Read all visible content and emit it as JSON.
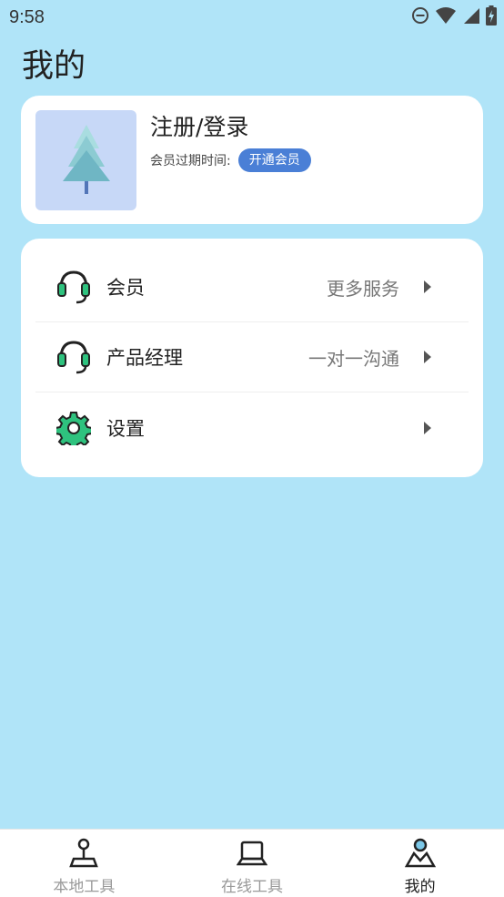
{
  "status_bar": {
    "time": "9:58"
  },
  "page": {
    "title": "我的"
  },
  "profile": {
    "login_label": "注册/登录",
    "member_expiry_label": "会员过期时间:",
    "open_member_button": "开通会员"
  },
  "menu": {
    "items": [
      {
        "label": "会员",
        "value": "更多服务",
        "icon": "headset-icon"
      },
      {
        "label": "产品经理",
        "value": "一对一沟通",
        "icon": "headset-icon"
      },
      {
        "label": "设置",
        "value": "",
        "icon": "gear-icon"
      }
    ]
  },
  "tabs": [
    {
      "label": "本地工具",
      "icon": "joystick-icon",
      "active": false
    },
    {
      "label": "在线工具",
      "icon": "laptop-icon",
      "active": false
    },
    {
      "label": "我的",
      "icon": "profile-icon",
      "active": true
    }
  ],
  "colors": {
    "background": "#b0e4f8",
    "accent": "#4a7fd6",
    "icon_green": "#2ec27e",
    "avatar_bg": "#c7d8f7"
  }
}
